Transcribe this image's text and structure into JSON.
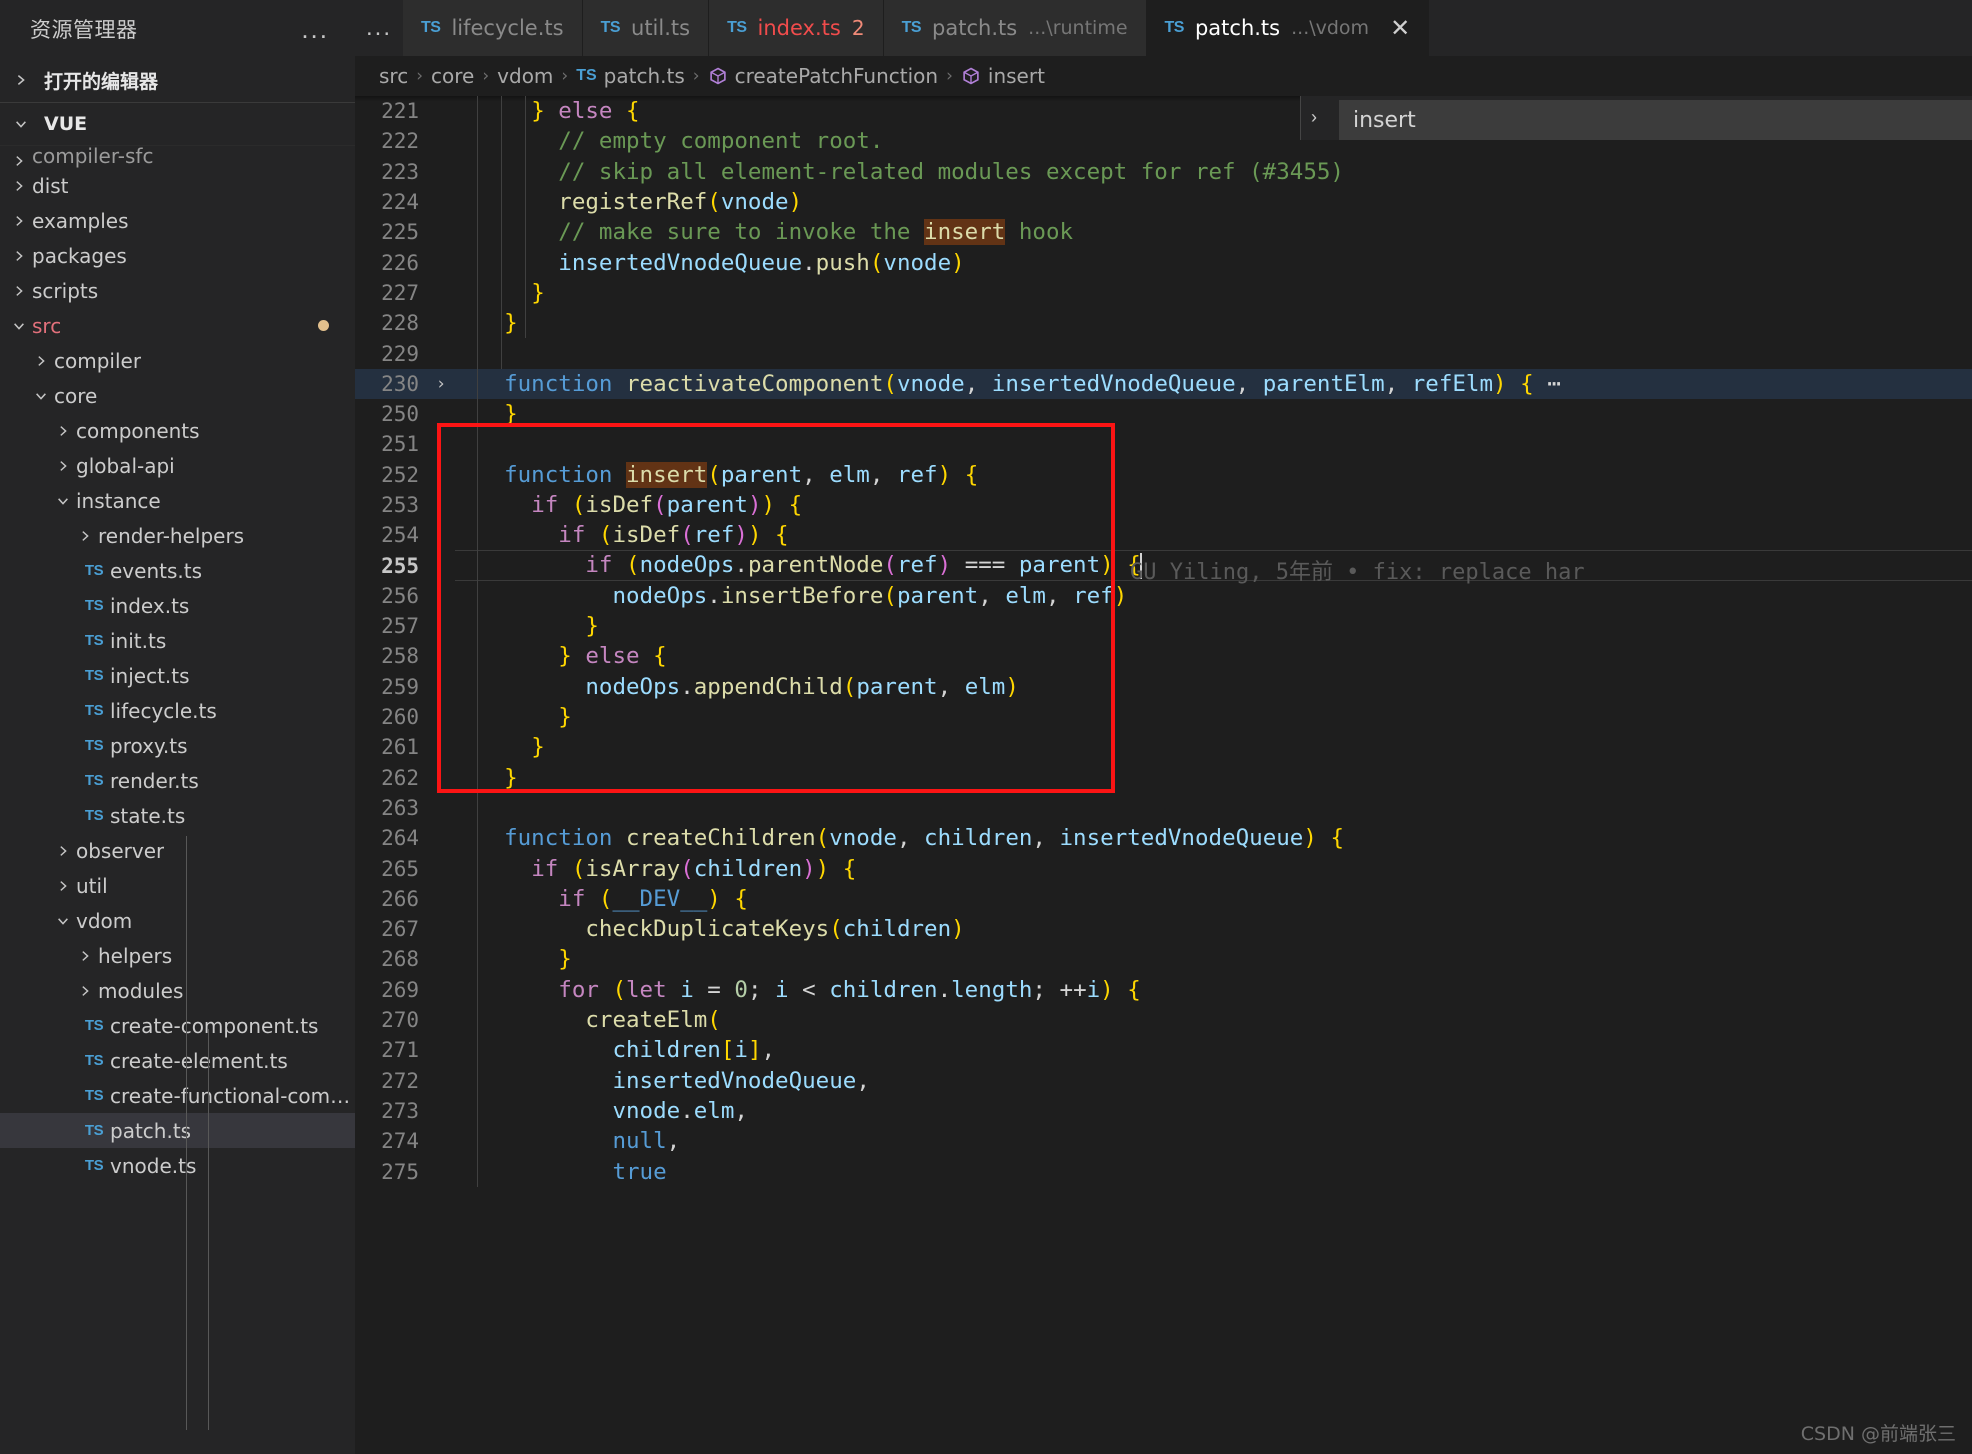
{
  "sidebar": {
    "title": "资源管理器",
    "more_label": "...",
    "open_editors_label": "打开的编辑器",
    "workspace_label": "VUE",
    "items": [
      {
        "label": "compiler-sfc",
        "type": "folder",
        "indent": 1,
        "expanded": false,
        "clipped": true
      },
      {
        "label": "dist",
        "type": "folder",
        "indent": 1,
        "expanded": false
      },
      {
        "label": "examples",
        "type": "folder",
        "indent": 1,
        "expanded": false
      },
      {
        "label": "packages",
        "type": "folder",
        "indent": 1,
        "expanded": false
      },
      {
        "label": "scripts",
        "type": "folder",
        "indent": 1,
        "expanded": false
      },
      {
        "label": "src",
        "type": "folder",
        "indent": 1,
        "expanded": true,
        "modified": true,
        "dot": true
      },
      {
        "label": "compiler",
        "type": "folder",
        "indent": 2,
        "expanded": false
      },
      {
        "label": "core",
        "type": "folder",
        "indent": 2,
        "expanded": true
      },
      {
        "label": "components",
        "type": "folder",
        "indent": 3,
        "expanded": false
      },
      {
        "label": "global-api",
        "type": "folder",
        "indent": 3,
        "expanded": false
      },
      {
        "label": "instance",
        "type": "folder",
        "indent": 3,
        "expanded": true
      },
      {
        "label": "render-helpers",
        "type": "folder",
        "indent": 4,
        "expanded": false
      },
      {
        "label": "events.ts",
        "type": "file",
        "indent": 4
      },
      {
        "label": "index.ts",
        "type": "file",
        "indent": 4
      },
      {
        "label": "init.ts",
        "type": "file",
        "indent": 4
      },
      {
        "label": "inject.ts",
        "type": "file",
        "indent": 4
      },
      {
        "label": "lifecycle.ts",
        "type": "file",
        "indent": 4
      },
      {
        "label": "proxy.ts",
        "type": "file",
        "indent": 4
      },
      {
        "label": "render.ts",
        "type": "file",
        "indent": 4
      },
      {
        "label": "state.ts",
        "type": "file",
        "indent": 4
      },
      {
        "label": "observer",
        "type": "folder",
        "indent": 3,
        "expanded": false
      },
      {
        "label": "util",
        "type": "folder",
        "indent": 3,
        "expanded": false
      },
      {
        "label": "vdom",
        "type": "folder",
        "indent": 3,
        "expanded": true
      },
      {
        "label": "helpers",
        "type": "folder",
        "indent": 4,
        "expanded": false
      },
      {
        "label": "modules",
        "type": "folder",
        "indent": 4,
        "expanded": false
      },
      {
        "label": "create-component.ts",
        "type": "file",
        "indent": 4
      },
      {
        "label": "create-element.ts",
        "type": "file",
        "indent": 4
      },
      {
        "label": "create-functional-compone…",
        "type": "file",
        "indent": 4
      },
      {
        "label": "patch.ts",
        "type": "file",
        "indent": 4,
        "selected": true
      },
      {
        "label": "vnode.ts",
        "type": "file",
        "indent": 4
      }
    ]
  },
  "tabs": {
    "overflow_label": "...",
    "items": [
      {
        "icon": "TS",
        "name": "lifecycle.ts",
        "path": "",
        "active": false,
        "error": false,
        "badge": ""
      },
      {
        "icon": "TS",
        "name": "util.ts",
        "path": "",
        "active": false,
        "error": false,
        "badge": ""
      },
      {
        "icon": "TS",
        "name": "index.ts",
        "path": "",
        "active": false,
        "error": true,
        "badge": "2"
      },
      {
        "icon": "TS",
        "name": "patch.ts",
        "path": "...\\runtime",
        "active": false,
        "error": false,
        "badge": ""
      },
      {
        "icon": "TS",
        "name": "patch.ts",
        "path": "...\\vdom",
        "active": true,
        "error": false,
        "badge": "",
        "close": "✕"
      }
    ]
  },
  "breadcrumb": {
    "parts": [
      "src",
      "core",
      "vdom",
      "patch.ts",
      "createPatchFunction",
      "insert"
    ],
    "separator": "›",
    "file_icon": "TS",
    "symbol_icon": "⬡"
  },
  "outline_popup": {
    "label": "insert",
    "chevron": "›"
  },
  "blame": {
    "text": "GU Yiling, 5年前 • fix: replace har",
    "line": 255
  },
  "watermark": {
    "text": "CSDN @前端张三"
  },
  "editor": {
    "first_line": 221,
    "lines": [
      {
        "n": "221",
        "fold": "",
        "indent": 0
      },
      {
        "n": "222",
        "fold": "",
        "indent": 0
      },
      {
        "n": "223",
        "fold": "",
        "indent": 0
      },
      {
        "n": "224",
        "fold": "",
        "indent": 0
      },
      {
        "n": "225",
        "fold": "",
        "indent": 0
      },
      {
        "n": "226",
        "fold": "",
        "indent": 0
      },
      {
        "n": "227",
        "fold": "",
        "indent": 0
      },
      {
        "n": "228",
        "fold": "",
        "indent": 0
      },
      {
        "n": "229",
        "fold": "",
        "indent": 0
      },
      {
        "n": "230",
        "fold": "›",
        "indent": 0,
        "folded": true
      },
      {
        "n": "250",
        "fold": "",
        "indent": 0
      },
      {
        "n": "251",
        "fold": "",
        "indent": 0
      },
      {
        "n": "252",
        "fold": "",
        "indent": 0
      },
      {
        "n": "253",
        "fold": "",
        "indent": 0
      },
      {
        "n": "254",
        "fold": "",
        "indent": 0
      },
      {
        "n": "255",
        "fold": "",
        "indent": 0,
        "current": true
      },
      {
        "n": "256",
        "fold": "",
        "indent": 0
      },
      {
        "n": "257",
        "fold": "",
        "indent": 0
      },
      {
        "n": "258",
        "fold": "",
        "indent": 0
      },
      {
        "n": "259",
        "fold": "",
        "indent": 0
      },
      {
        "n": "260",
        "fold": "",
        "indent": 0
      },
      {
        "n": "261",
        "fold": "",
        "indent": 0
      },
      {
        "n": "262",
        "fold": "",
        "indent": 0
      },
      {
        "n": "263",
        "fold": "",
        "indent": 0
      },
      {
        "n": "264",
        "fold": "",
        "indent": 0
      },
      {
        "n": "265",
        "fold": "",
        "indent": 0
      },
      {
        "n": "266",
        "fold": "",
        "indent": 0
      },
      {
        "n": "267",
        "fold": "",
        "indent": 0
      },
      {
        "n": "268",
        "fold": "",
        "indent": 0
      },
      {
        "n": "269",
        "fold": "",
        "indent": 0
      },
      {
        "n": "270",
        "fold": "",
        "indent": 0
      },
      {
        "n": "271",
        "fold": "",
        "indent": 0
      },
      {
        "n": "272",
        "fold": "",
        "indent": 0
      },
      {
        "n": "273",
        "fold": "",
        "indent": 0
      },
      {
        "n": "274",
        "fold": "",
        "indent": 0
      },
      {
        "n": "275",
        "fold": "",
        "indent": 0
      }
    ],
    "source_text": [
      "    } else {",
      "      // empty component root.",
      "      // skip all element-related modules except for ref (#3455)",
      "      registerRef(vnode)",
      "      // make sure to invoke the insert hook",
      "      insertedVnodeQueue.push(vnode)",
      "    }",
      "  }",
      "",
      "  function reactivateComponent(vnode, insertedVnodeQueue, parentElm, refElm) { ⋯",
      "  }",
      "",
      "  function insert(parent, elm, ref) {",
      "    if (isDef(parent)) {",
      "      if (isDef(ref)) {",
      "        if (nodeOps.parentNode(ref) === parent) {",
      "          nodeOps.insertBefore(parent, elm, ref)",
      "        }",
      "      } else {",
      "        nodeOps.appendChild(parent, elm)",
      "      }",
      "    }",
      "  }",
      "",
      "  function createChildren(vnode, children, insertedVnodeQueue) {",
      "    if (isArray(children)) {",
      "      if (__DEV__) {",
      "        checkDuplicateKeys(children)",
      "      }",
      "      for (let i = 0; i < children.length; ++i) {",
      "        createElm(",
      "          children[i],",
      "          insertedVnodeQueue,",
      "          vnode.elm,",
      "          null,",
      "          true"
    ]
  },
  "colors": {
    "editor_bg": "#1e1e1e",
    "sidebar_bg": "#252526",
    "tab_inactive_bg": "#2d2d2d",
    "accent_red_box": "#fb1414",
    "modified_file": "#e2707b",
    "error_red": "#f14c4c",
    "keyword_purple": "#c586c0",
    "keyword_blue": "#569cd6",
    "function_yellow": "#dcdcaa",
    "variable_blue": "#9cdcfe",
    "comment_green": "#6a9955",
    "highlight_orange": "#623315"
  }
}
